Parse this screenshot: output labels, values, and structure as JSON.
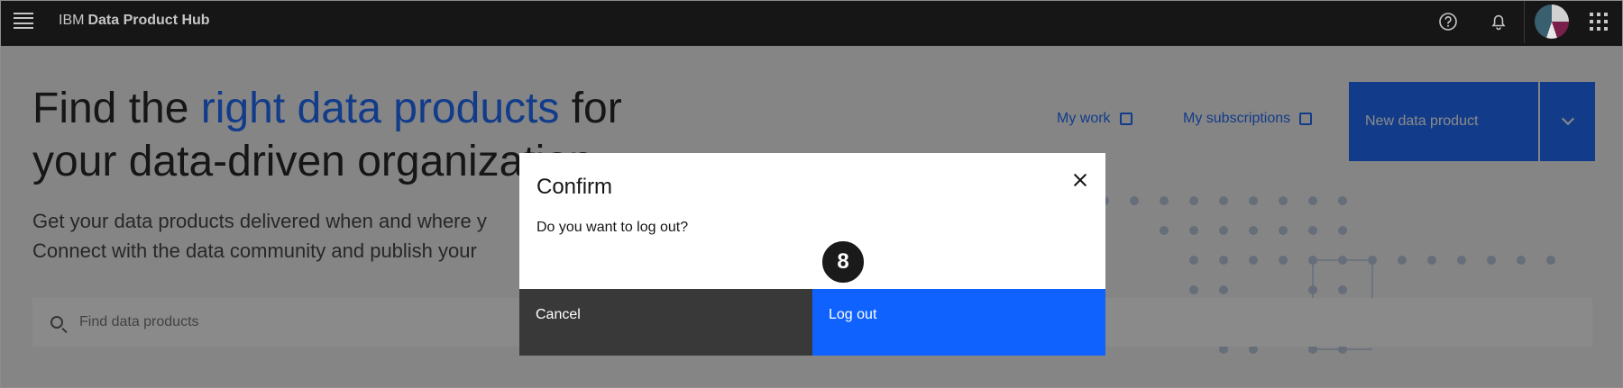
{
  "header": {
    "brand_prefix": "IBM",
    "brand_name": "Data Product Hub",
    "icons": [
      "menu-icon",
      "help-icon",
      "notification-icon",
      "avatar",
      "app-switcher-icon"
    ]
  },
  "hero": {
    "title_part1": "Find the ",
    "title_accent": "right data products",
    "title_part2": " for",
    "title_line2": "your data-driven organiza",
    "title_line2_tail": "tion",
    "subtitle_line1": "Get your data products delivered when and where y",
    "subtitle_line2": "Connect with the data community and publish your"
  },
  "toolbar": {
    "my_work": "My work",
    "my_subscriptions": "My subscriptions",
    "new_data_product": "New data product"
  },
  "search": {
    "placeholder": "Find data products"
  },
  "modal": {
    "title": "Confirm",
    "body": "Do you want to log out?",
    "cancel_label": "Cancel",
    "logout_label": "Log out"
  },
  "step_badge": "8",
  "colors": {
    "accent": "#0f62fe",
    "header_bg": "#161616",
    "secondary_button": "#393939"
  }
}
